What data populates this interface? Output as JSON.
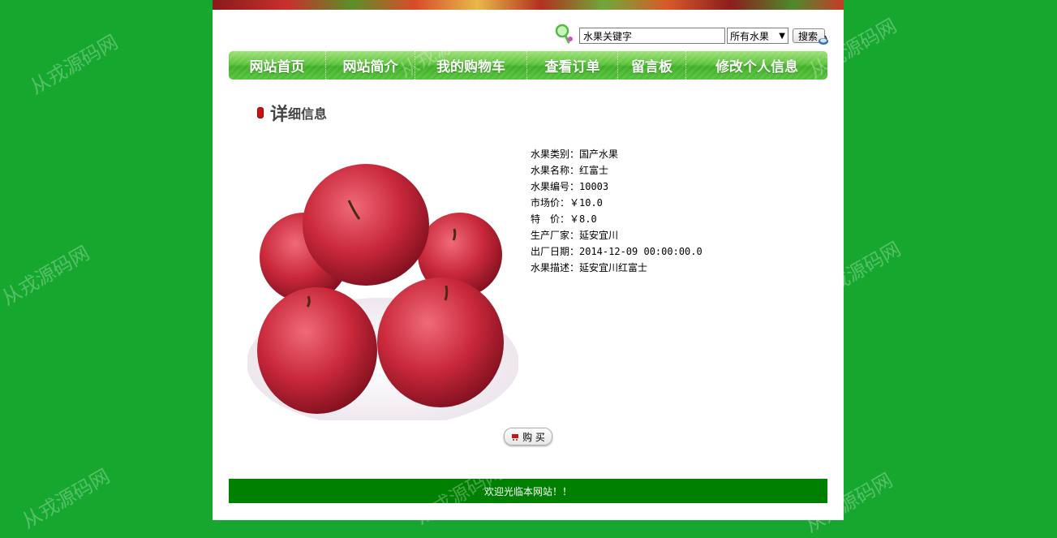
{
  "watermark_text": "从戎源码网",
  "search": {
    "input_value": "水果关键字",
    "select_value": "所有水果",
    "button_label": "搜索"
  },
  "nav": {
    "items": [
      {
        "label": "网站首页"
      },
      {
        "label": "网站简介"
      },
      {
        "label": "我的购物车"
      },
      {
        "label": "查看订单"
      },
      {
        "label": "留言板"
      },
      {
        "label": "修改个人信息"
      }
    ]
  },
  "section": {
    "title_big": "详",
    "title_small": "细信息"
  },
  "details": {
    "rows": [
      {
        "text": "水果类别：国产水果"
      },
      {
        "text": "水果名称：红富士"
      },
      {
        "text": "水果编号：10003"
      },
      {
        "text": "市场价：￥10.0"
      },
      {
        "text": "特　价：￥8.0"
      },
      {
        "text": "生产厂家：延安宜川"
      },
      {
        "text": "出厂日期：2014-12-09 00:00:00.0"
      },
      {
        "text": "水果描述：延安宜川红富士"
      }
    ]
  },
  "buy_button": {
    "label": "购 买"
  },
  "footer": {
    "text": "欢迎光临本网站！！"
  },
  "colors": {
    "background": "#16a72f",
    "nav_green": "#4cbb30",
    "footer_green": "#008000",
    "apple_red": "#c8283a"
  }
}
